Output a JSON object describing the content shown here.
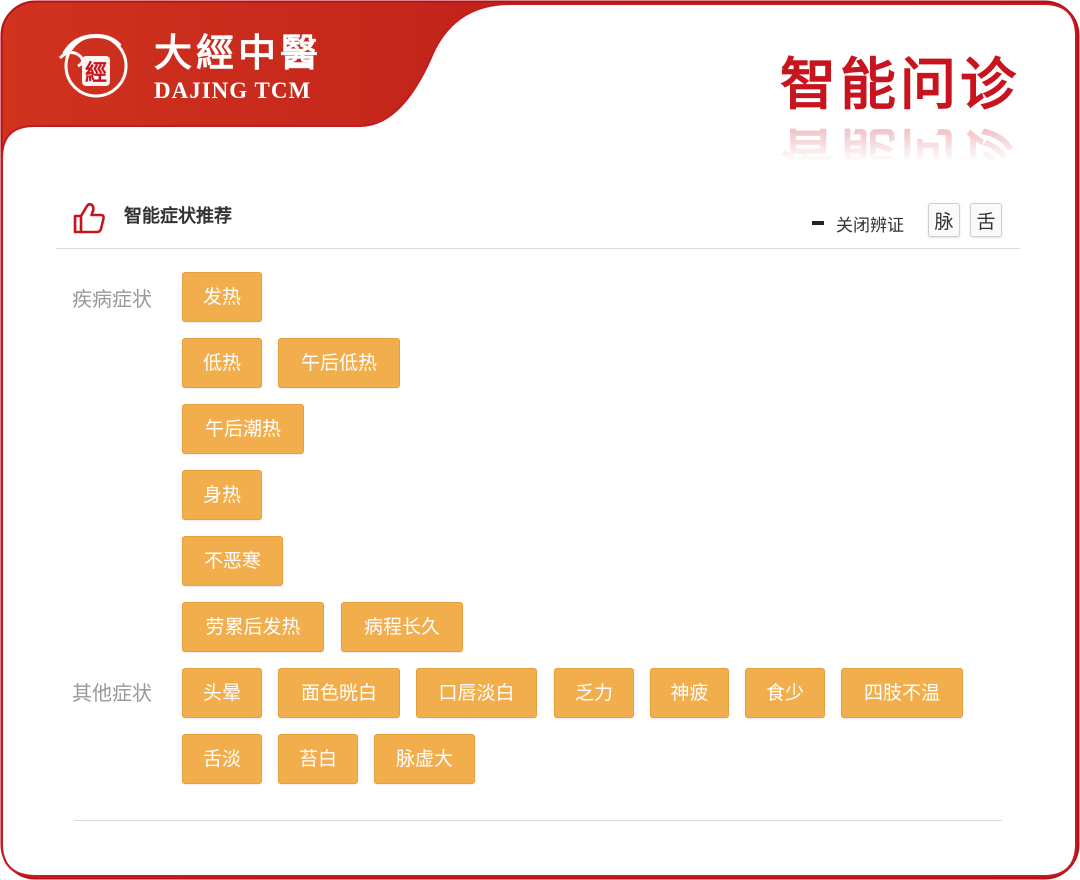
{
  "brand": {
    "name_cn": "大經中醫",
    "name_en": "DAJING TCM",
    "seal_char": "經"
  },
  "page_title": "智能问诊",
  "section": {
    "title": "智能症状推荐",
    "toggle_label": "关闭辨证",
    "tag_buttons": [
      "脉",
      "舌"
    ]
  },
  "categories": [
    {
      "label": "疾病症状",
      "symptoms": [
        "发热",
        "低热",
        "午后低热",
        "午后潮热",
        "身热",
        "不恶寒",
        "劳累后发热",
        "病程长久"
      ]
    },
    {
      "label": "其他症状",
      "symptoms": [
        "头晕",
        "面色晄白",
        "口唇淡白",
        "乏力",
        "神疲",
        "食少",
        "四肢不温",
        "舌淡",
        "苔白",
        "脉虚大"
      ]
    }
  ],
  "colors": {
    "brand_red": "#c8141e",
    "chip": "#f2ad4d",
    "label_gray": "#999999"
  },
  "icons": {
    "section": "thumbs-up-icon",
    "toggle": "minus-icon",
    "logo": "seal-logo-icon"
  }
}
